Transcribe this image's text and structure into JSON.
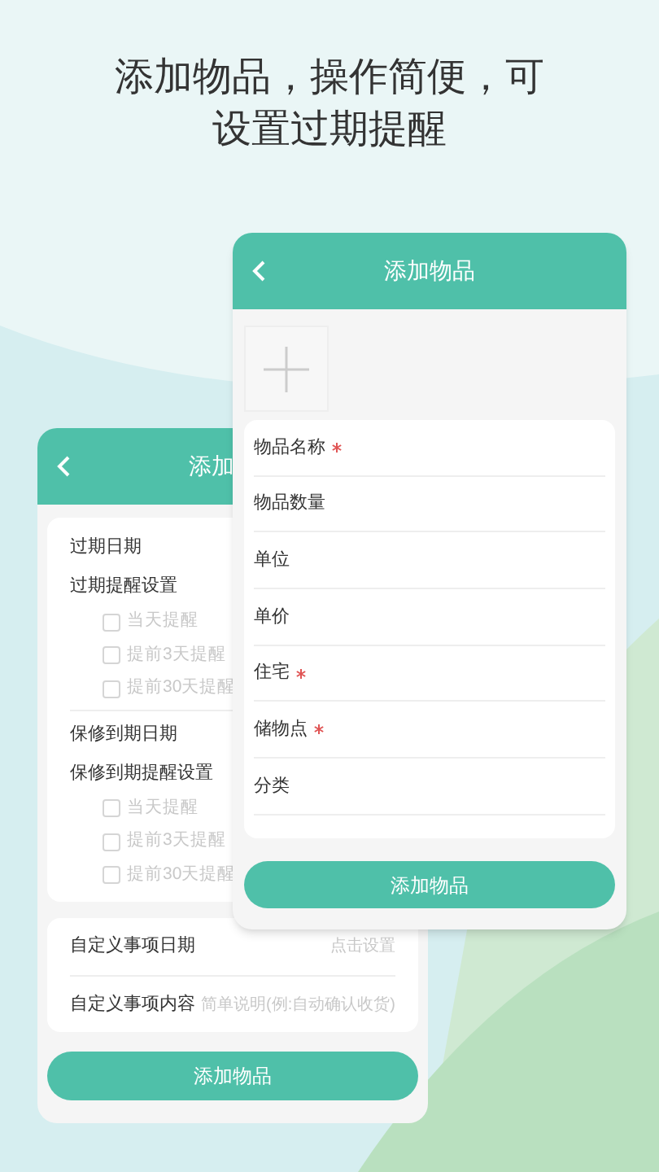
{
  "headline": [
    "添加物品，操作简便，可",
    "设置过期提醒"
  ],
  "back_screen": {
    "title": "添加",
    "sections": [
      {
        "rows": [
          {
            "kind": "label",
            "label": "过期日期"
          },
          {
            "kind": "label",
            "label": "过期提醒设置"
          },
          {
            "kind": "checkbox",
            "label": "当天提醒",
            "checked": false
          },
          {
            "kind": "checkbox",
            "label": "提前3天提醒",
            "checked": false
          },
          {
            "kind": "checkbox",
            "label": "提前30天提醒",
            "checked": false
          }
        ]
      },
      {
        "rows": [
          {
            "kind": "label",
            "label": "保修到期日期"
          },
          {
            "kind": "label",
            "label": "保修到期提醒设置"
          },
          {
            "kind": "checkbox",
            "label": "当天提醒",
            "checked": false
          },
          {
            "kind": "checkbox",
            "label": "提前3天提醒",
            "checked": false
          },
          {
            "kind": "checkbox",
            "label": "提前30天提醒",
            "checked": false
          }
        ]
      }
    ],
    "custom_rows": [
      {
        "label": "自定义事项日期",
        "value": "点击设置"
      },
      {
        "label": "自定义事项内容",
        "value": "简单说明(例:自动确认收货)"
      }
    ],
    "button": "添加物品"
  },
  "front_screen": {
    "title": "添加物品",
    "fields": [
      {
        "label": "物品名称",
        "required": true
      },
      {
        "label": "物品数量",
        "required": false
      },
      {
        "label": "单位",
        "required": false
      },
      {
        "label": "单价",
        "required": false
      },
      {
        "label": "住宅",
        "required": true
      },
      {
        "label": "储物点",
        "required": true
      },
      {
        "label": "分类",
        "required": false
      }
    ],
    "button": "添加物品"
  }
}
